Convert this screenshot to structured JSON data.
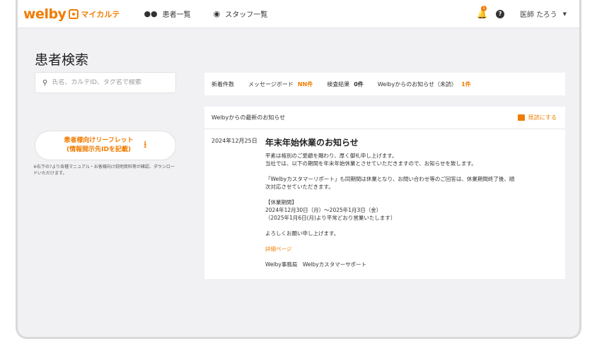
{
  "app": {
    "logo_text": "welby",
    "logo_sub": "マイカルテ"
  },
  "nav": [
    {
      "label": "患者一覧",
      "icon": "people-icon"
    },
    {
      "label": "スタッフ一覧",
      "icon": "staff-icon"
    }
  ],
  "header": {
    "notification_count": "1",
    "user_name": "医師 たろう"
  },
  "page": {
    "title": "患者検索"
  },
  "search": {
    "placeholder": "氏名、カルテID、タグ名で検索",
    "value": ""
  },
  "leaflet": {
    "line1": "患者様向けリーフレット",
    "line2": "(情報開示先IDを記載)",
    "note": "※右下の?より各種マニュアル・お客様向け説明資料等が確認、ダウンロードいただけます。"
  },
  "stats": {
    "new_label": "新着件数",
    "message_label": "メッセージボード",
    "message_count": "NN件",
    "exam_label": "検査結果",
    "exam_count": "0件",
    "unread_label": "Welbyからのお知らせ（未読）",
    "unread_count": "1件"
  },
  "notice": {
    "header": "Welbyからの最新のお知らせ",
    "archive_label": "既読にする",
    "date": "2024年12月25日",
    "title": "年末年始休業のお知らせ",
    "para1_line1": "平素は格別のご愛顧を賜わり、厚く御礼申し上げます。",
    "para1_line2": "当社では、以下の期間を年末年始休業とさせていただきますので、お知らせを致します。",
    "para2_line1": "「Welbyカスタマーリポート」も同期間は休業となり、お問い合わせ等のご回答は、休業期間終了後、順",
    "para2_line2": "次対応させていただきます。",
    "period_label": "【休業期間】",
    "period_line1": "2024年12月30日（月）～2025年1月3日（金）",
    "period_line2": "（2025年1月6日(月)より平常どおり営業いたします）",
    "closing": "よろしくお願い申し上げます。",
    "detail_link": "詳細ページ",
    "signature": "Welby事務局　Welbyカスタマーサポート"
  }
}
